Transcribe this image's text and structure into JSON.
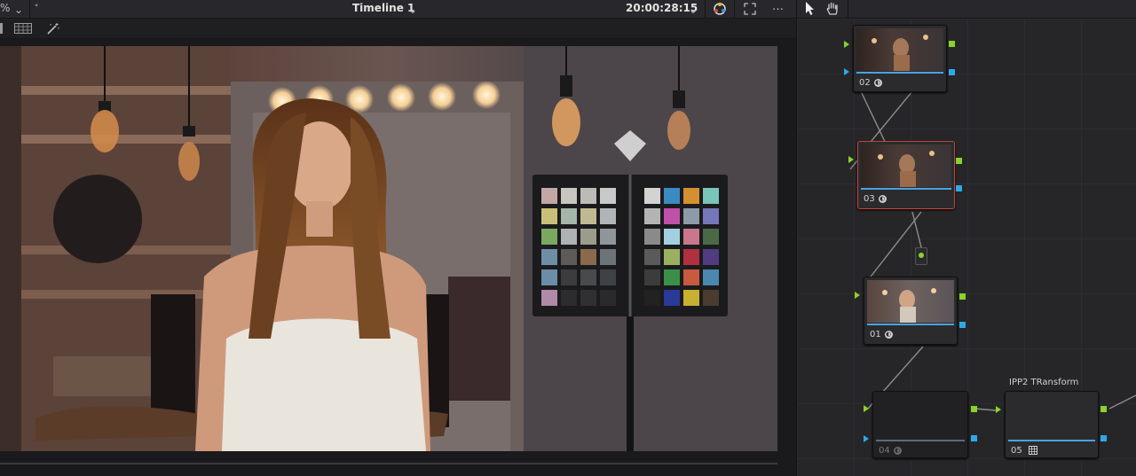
{
  "toolbar": {
    "zoom_label": "%",
    "timeline_title": "Timeline 1",
    "timecode": "20:00:28:15"
  },
  "nodes": [
    {
      "label": "02"
    },
    {
      "label": "03"
    },
    {
      "label": "01"
    },
    {
      "label": "04"
    },
    {
      "label": "05",
      "title": "IPP2 TRansform"
    }
  ],
  "colors": {
    "selected_border": "#c6453c",
    "input_port": "#88d42a",
    "output_port": "#2ea9e8"
  }
}
